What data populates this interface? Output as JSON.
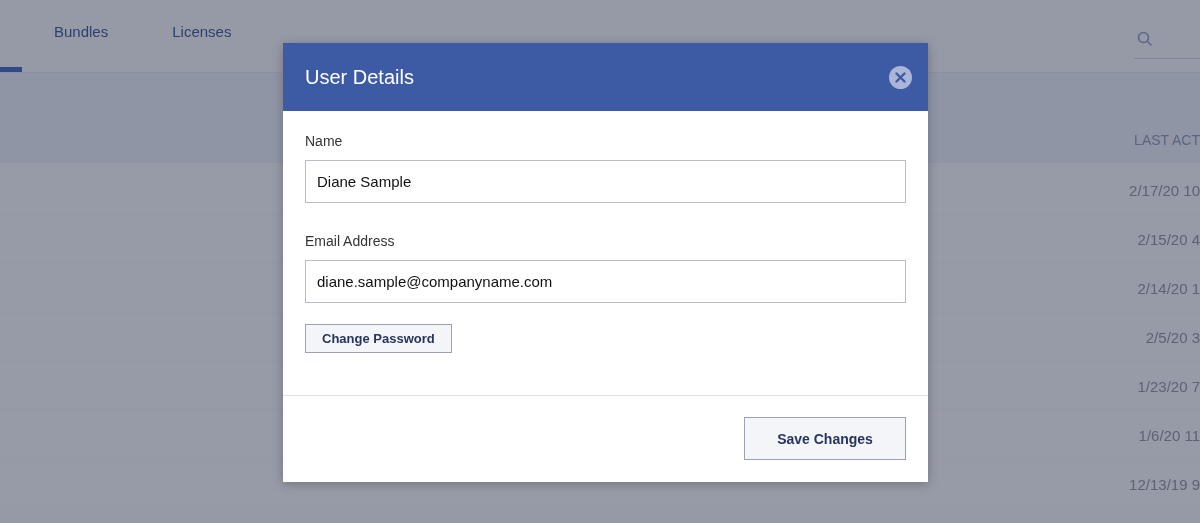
{
  "tabs": [
    {
      "selected": true
    },
    {
      "label": "Bundles",
      "selected": false
    },
    {
      "label": "Licenses",
      "selected": false
    }
  ],
  "table": {
    "columns": [
      "LAST ACT"
    ],
    "rows": [
      {
        "last_activity": "2/17/20 10"
      },
      {
        "last_activity": "2/15/20 4"
      },
      {
        "last_activity": "2/14/20 1"
      },
      {
        "last_activity": "2/5/20 3"
      },
      {
        "last_activity": "1/23/20 7"
      },
      {
        "last_activity": "1/6/20 11"
      },
      {
        "last_activity": "12/13/19 9"
      }
    ]
  },
  "dialog": {
    "title": "User Details",
    "fields": [
      {
        "label": "Name",
        "value": "Diane Sample"
      },
      {
        "label": "Email Address",
        "value": "diane.sample@companyname.com"
      }
    ],
    "secondary_button": "Change Password",
    "primary_button": "Save Changes"
  }
}
